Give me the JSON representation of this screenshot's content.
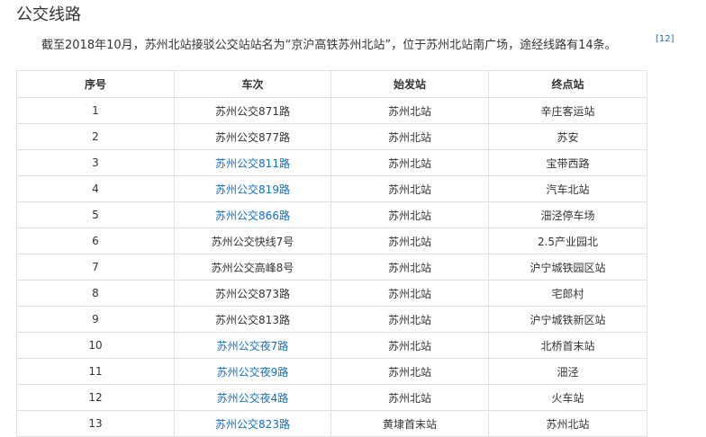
{
  "section": {
    "title": "公交线路"
  },
  "intro": {
    "text": "截至2018年10月，苏州北站接驳公交站站名为“京沪高铁苏州北站”，位于苏州北站南广场，途经线路有14条。",
    "citation": "[12]"
  },
  "table": {
    "headers": [
      "序号",
      "车次",
      "始发站",
      "终点站"
    ],
    "rows": [
      {
        "no": "1",
        "route": "苏州公交871路",
        "route_is_link": false,
        "origin": "苏州北站",
        "terminus": "辛庄客运站"
      },
      {
        "no": "2",
        "route": "苏州公交877路",
        "route_is_link": false,
        "origin": "苏州北站",
        "terminus": "苏安"
      },
      {
        "no": "3",
        "route": "苏州公交811路",
        "route_is_link": true,
        "origin": "苏州北站",
        "terminus": "宝带西路"
      },
      {
        "no": "4",
        "route": "苏州公交819路",
        "route_is_link": true,
        "origin": "苏州北站",
        "terminus": "汽车北站"
      },
      {
        "no": "5",
        "route": "苏州公交866路",
        "route_is_link": true,
        "origin": "苏州北站",
        "terminus": "沺泾停车场"
      },
      {
        "no": "6",
        "route": "苏州公交快线7号",
        "route_is_link": false,
        "origin": "苏州北站",
        "terminus": "2.5产业园北"
      },
      {
        "no": "7",
        "route": "苏州公交高峰8号",
        "route_is_link": false,
        "origin": "苏州北站",
        "terminus": "沪宁城铁园区站"
      },
      {
        "no": "8",
        "route": "苏州公交873路",
        "route_is_link": false,
        "origin": "苏州北站",
        "terminus": "宅郎村"
      },
      {
        "no": "9",
        "route": "苏州公交813路",
        "route_is_link": false,
        "origin": "苏州北站",
        "terminus": "沪宁城铁新区站"
      },
      {
        "no": "10",
        "route": "苏州公交夜7路",
        "route_is_link": true,
        "origin": "苏州北站",
        "terminus": "北桥首末站"
      },
      {
        "no": "11",
        "route": "苏州公交夜9路",
        "route_is_link": true,
        "origin": "苏州北站",
        "terminus": "沺泾"
      },
      {
        "no": "12",
        "route": "苏州公交夜4路",
        "route_is_link": true,
        "origin": "苏州北站",
        "terminus": "火车站"
      },
      {
        "no": "13",
        "route": "苏州公交823路",
        "route_is_link": true,
        "origin": "黄埭首末站",
        "terminus": "苏州北站"
      }
    ]
  },
  "colors": {
    "text": "#333333",
    "link": "#136ec2",
    "border": "#e0e0e0"
  }
}
